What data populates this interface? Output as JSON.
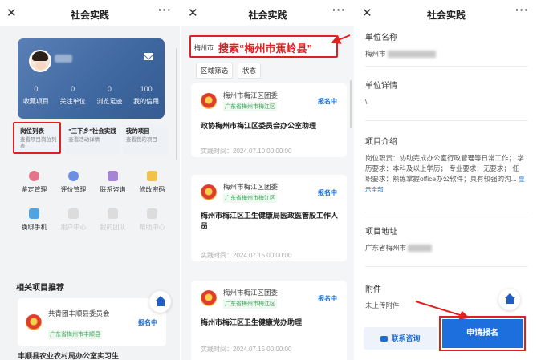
{
  "nav": {
    "close": "✕",
    "title": "社会实践",
    "more": "···"
  },
  "panel1": {
    "stats": [
      {
        "num": "0",
        "label": "收藏项目"
      },
      {
        "num": "0",
        "label": "关注单位"
      },
      {
        "num": "0",
        "label": "浏览足迹"
      },
      {
        "num": "100",
        "label": "我的信用"
      }
    ],
    "cards": [
      {
        "title": "岗位列表",
        "sub": "查看项目岗位列表"
      },
      {
        "title": "\"三下乡\"社会实践",
        "sub": "查看活动详情"
      },
      {
        "title": "我的项目",
        "sub": "查看我的项目"
      }
    ],
    "grid": [
      {
        "label": "鉴定管理"
      },
      {
        "label": "评价管理"
      },
      {
        "label": "联系咨询"
      },
      {
        "label": "修改密码"
      },
      {
        "label": "换绑手机"
      },
      {
        "label": "用户中心"
      },
      {
        "label": "我的团队"
      },
      {
        "label": "帮助中心"
      }
    ],
    "section_title": "相关项目推荐",
    "rec": {
      "org": "共青团丰顺县委员会",
      "place": "广东省梅州市丰顺县",
      "badge": "报名中",
      "next_title": "丰顺县农业农村局办公室实习生"
    }
  },
  "panel2": {
    "search_value": "梅州市",
    "search_note": "搜索“梅州市蕉岭县”",
    "filters": [
      "区域筛选",
      "状态"
    ],
    "jobs": [
      {
        "org": "梅州市梅江区团委",
        "place": "广东省梅州市梅江区",
        "badge": "报名中",
        "title": "政协梅州市梅江区委员会办公室助理",
        "time": "实践时间：2024.07.10 00:00:00"
      },
      {
        "org": "梅州市梅江区团委",
        "place": "广东省梅州市梅江区",
        "badge": "报名中",
        "title": "梅州市梅江区卫生健康局医政医管股工作人员",
        "time": "实践时间：2024.07.15 00:00:00"
      },
      {
        "org": "梅州市梅江区团委",
        "place": "广东省梅州市梅江区",
        "badge": "报名中",
        "title": "梅州市梅江区卫生健康党办助理",
        "time": "实践时间：2024.07.15 00:00:00"
      }
    ]
  },
  "panel3": {
    "unit_name_label": "单位名称",
    "unit_name_value": "梅州市",
    "unit_detail_label": "单位详情",
    "unit_detail_value": "\\",
    "intro_label": "项目介绍",
    "intro_value": "岗位职责：协助完成办公室行政管理等日常工作； 学历要求：本科及以上学历； 专业要求：无要求； 任职要求：熟练掌握office办公软件；具有较强的沟...",
    "show_all": "显示全部",
    "address_label": "项目地址",
    "address_value": "广东省梅州市",
    "attach_label": "附件",
    "attach_value": "未上传附件",
    "consult": "联系咨询",
    "apply": "申请报名"
  }
}
